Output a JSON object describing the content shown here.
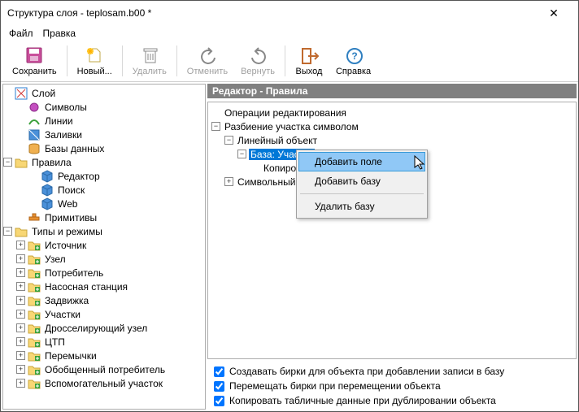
{
  "window": {
    "title": "Структура слоя - teplosam.b00 *"
  },
  "menu": {
    "file": "Файл",
    "edit": "Правка"
  },
  "toolbar": {
    "save": "Сохранить",
    "new": "Новый...",
    "delete": "Удалить",
    "undo": "Отменить",
    "redo": "Вернуть",
    "exit": "Выход",
    "help": "Справка"
  },
  "left_tree": {
    "root": "Слой",
    "symbols": "Символы",
    "lines": "Линии",
    "fills": "Заливки",
    "databases": "Базы данных",
    "rules": "Правила",
    "editor": "Редактор",
    "search": "Поиск",
    "web": "Web",
    "primitives": "Примитивы",
    "types": "Типы и режимы",
    "types_items": [
      "Источник",
      "Узел",
      "Потребитель",
      "Насосная станция",
      "Задвижка",
      "Участки",
      "Дросселирующий узел",
      "ЦТП",
      "Перемычки",
      "Обобщенный потребитель",
      "Вспомогательный участок"
    ]
  },
  "right": {
    "header": "Редактор - Правила",
    "ops": "Операции редактирования",
    "split": "Разбиение участка символом",
    "linear_obj": "Линейный объект",
    "base": "База: Участки",
    "copy": "Копирова",
    "sym_obj": "Символьный объ"
  },
  "ctx": {
    "add_field": "Добавить поле",
    "add_base": "Добавить базу",
    "del_base": "Удалить базу"
  },
  "checks": {
    "c1": "Создавать бирки для объекта при добавлении записи в  базу",
    "c2": "Перемещать бирки при перемещении объекта",
    "c3": "Копировать табличные данные при дублировании объекта"
  },
  "icons": {
    "layer": "layer-icon",
    "circle_violet": "symbol-icon",
    "line_green": "line-icon",
    "fill_blue": "fill-icon",
    "db_orange": "db-icon",
    "folder": "folder-icon",
    "cube_blue": "cube-icon",
    "tool": "primitives-icon",
    "folder_plus": "folder-plus-icon"
  }
}
